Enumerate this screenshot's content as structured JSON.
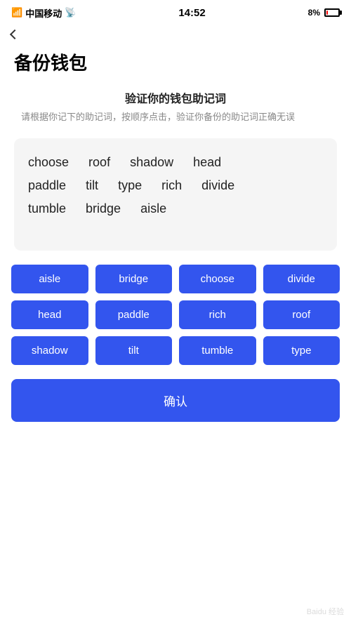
{
  "statusBar": {
    "carrier": "中国移动",
    "time": "14:52",
    "battery": "8%"
  },
  "backButton": {
    "label": "<"
  },
  "pageTitle": "备份钱包",
  "sectionHeader": {
    "title": "验证你的钱包助记词",
    "desc": "请根据你记下的助记词，按顺序点击，验证你备份的助记词正确无误"
  },
  "displayWords": {
    "row1": [
      "choose",
      "roof",
      "shadow",
      "head"
    ],
    "row2": [
      "paddle",
      "tilt",
      "type",
      "rich",
      "divide"
    ],
    "row3": [
      "tumble",
      "bridge",
      "aisle"
    ]
  },
  "wordButtons": [
    "aisle",
    "bridge",
    "choose",
    "divide",
    "head",
    "paddle",
    "rich",
    "roof",
    "shadow",
    "tilt",
    "tumble",
    "type"
  ],
  "confirmButton": "确认",
  "watermark": "Baidu 经验"
}
